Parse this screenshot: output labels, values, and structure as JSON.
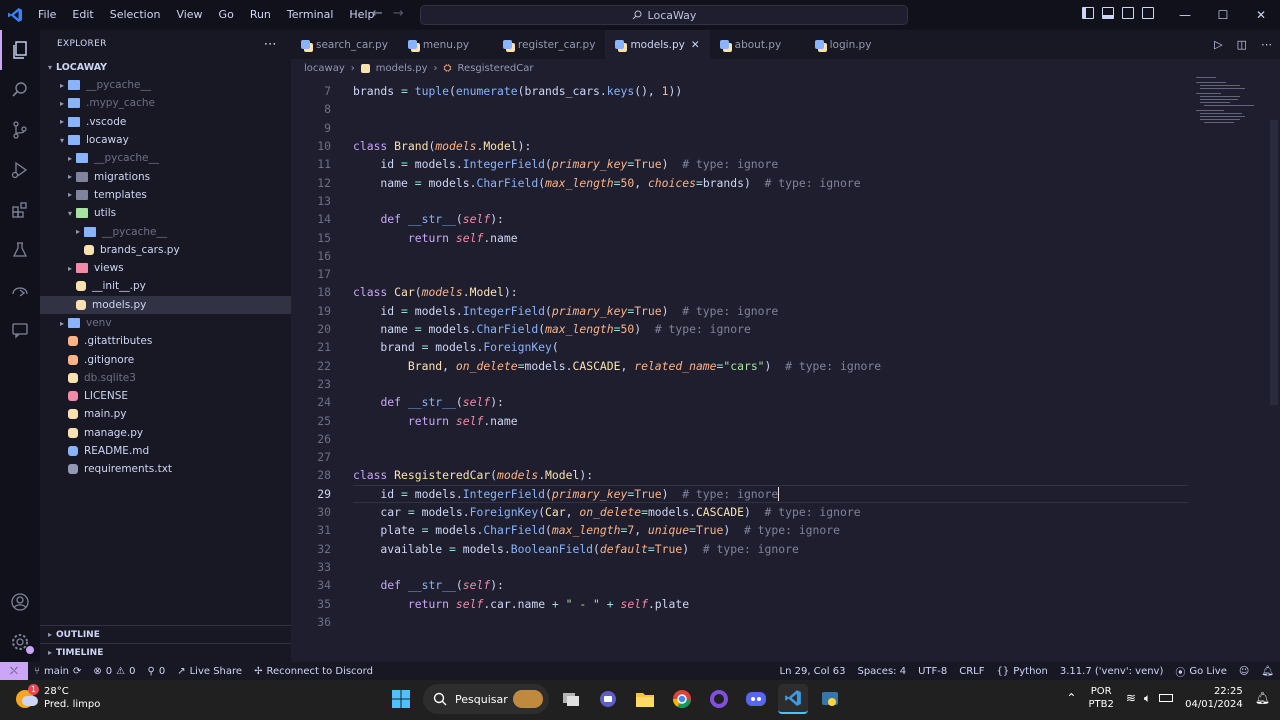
{
  "titlebar": {
    "menu": [
      "File",
      "Edit",
      "Selection",
      "View",
      "Go",
      "Run",
      "Terminal",
      "Help"
    ],
    "search_text": "LocaWay"
  },
  "explorer": {
    "title": "EXPLORER",
    "root": "LOCAWAY",
    "items": [
      {
        "label": "__pycache__",
        "depth": 1,
        "type": "folder",
        "color": "#89b4fa",
        "dim": true
      },
      {
        "label": ".mypy_cache",
        "depth": 1,
        "type": "folder",
        "color": "#89b4fa",
        "dim": true
      },
      {
        "label": ".vscode",
        "depth": 1,
        "type": "folder",
        "color": "#89b4fa",
        "dim": false
      },
      {
        "label": "locaway",
        "depth": 1,
        "type": "folder-open",
        "color": "#89b4fa",
        "dim": false
      },
      {
        "label": "__pycache__",
        "depth": 2,
        "type": "folder",
        "color": "#89b4fa",
        "dim": true
      },
      {
        "label": "migrations",
        "depth": 2,
        "type": "folder",
        "color": "#7f849c",
        "dim": false
      },
      {
        "label": "templates",
        "depth": 2,
        "type": "folder",
        "color": "#7f849c",
        "dim": false
      },
      {
        "label": "utils",
        "depth": 2,
        "type": "folder-open",
        "color": "#a6e3a1",
        "dim": false
      },
      {
        "label": "__pycache__",
        "depth": 3,
        "type": "folder",
        "color": "#89b4fa",
        "dim": true
      },
      {
        "label": "brands_cars.py",
        "depth": 3,
        "type": "py",
        "color": "#f9e2af",
        "dim": false
      },
      {
        "label": "views",
        "depth": 2,
        "type": "folder",
        "color": "#f38ba8",
        "dim": false
      },
      {
        "label": "__init__.py",
        "depth": 2,
        "type": "py",
        "color": "#f9e2af",
        "dim": false
      },
      {
        "label": "models.py",
        "depth": 2,
        "type": "py",
        "color": "#f9e2af",
        "dim": false,
        "selected": true
      },
      {
        "label": "venv",
        "depth": 1,
        "type": "folder",
        "color": "#89b4fa",
        "dim": true
      },
      {
        "label": ".gitattributes",
        "depth": 1,
        "type": "git",
        "color": "#fab387",
        "dim": false
      },
      {
        "label": ".gitignore",
        "depth": 1,
        "type": "git",
        "color": "#fab387",
        "dim": false
      },
      {
        "label": "db.sqlite3",
        "depth": 1,
        "type": "db",
        "color": "#f9e2af",
        "dim": true
      },
      {
        "label": "LICENSE",
        "depth": 1,
        "type": "license",
        "color": "#f38ba8",
        "dim": false
      },
      {
        "label": "main.py",
        "depth": 1,
        "type": "py",
        "color": "#f9e2af",
        "dim": false
      },
      {
        "label": "manage.py",
        "depth": 1,
        "type": "py",
        "color": "#f9e2af",
        "dim": false
      },
      {
        "label": "README.md",
        "depth": 1,
        "type": "md",
        "color": "#89b4fa",
        "dim": false
      },
      {
        "label": "requirements.txt",
        "depth": 1,
        "type": "txt",
        "color": "#9399b2",
        "dim": false
      }
    ],
    "outline": "OUTLINE",
    "timeline": "TIMELINE"
  },
  "tabs": [
    {
      "label": "search_car.py",
      "active": false
    },
    {
      "label": "menu.py",
      "active": false
    },
    {
      "label": "register_car.py",
      "active": false
    },
    {
      "label": "models.py",
      "active": true
    },
    {
      "label": "about.py",
      "active": false
    },
    {
      "label": "login.py",
      "active": false
    }
  ],
  "breadcrumb": [
    "locaway",
    "models.py",
    "ResgisteredCar"
  ],
  "code_lines": [
    {
      "n": "7",
      "html": "<span class='txt'>brands </span><span class='op'>=</span><span class='txt'> </span><span class='fn'>tuple</span><span class='txt'>(</span><span class='fn'>enumerate</span><span class='txt'>(brands_cars.</span><span class='fn'>keys</span><span class='txt'>(), </span><span class='num'>1</span><span class='txt'>))</span>"
    },
    {
      "n": "8",
      "html": ""
    },
    {
      "n": "9",
      "html": ""
    },
    {
      "n": "10",
      "html": "<span class='kw'>class</span><span class='txt'> </span><span class='cls'>Brand</span><span class='txt'>(</span><span class='param'>models</span><span class='txt'>.</span><span class='cls'>Model</span><span class='txt'>):</span>"
    },
    {
      "n": "11",
      "html": "<span class='txt'>    id </span><span class='op'>=</span><span class='txt'> models.</span><span class='fn'>IntegerField</span><span class='txt'>(</span><span class='param'>primary_key</span><span class='op'>=</span><span class='num'>True</span><span class='txt'>)  </span><span class='cmt'># type: ignore</span>"
    },
    {
      "n": "12",
      "html": "<span class='txt'>    name </span><span class='op'>=</span><span class='txt'> models.</span><span class='fn'>CharField</span><span class='txt'>(</span><span class='param'>max_length</span><span class='op'>=</span><span class='num'>50</span><span class='txt'>, </span><span class='param'>choices</span><span class='op'>=</span><span class='txt'>brands)  </span><span class='cmt'># type: ignore</span>"
    },
    {
      "n": "13",
      "html": ""
    },
    {
      "n": "14",
      "html": "<span class='txt'>    </span><span class='kw'>def</span><span class='txt'> </span><span class='fn'>__str__</span><span class='txt'>(</span><span class='self'>self</span><span class='txt'>):</span>"
    },
    {
      "n": "15",
      "html": "<span class='txt'>        </span><span class='kw'>return</span><span class='txt'> </span><span class='self'>self</span><span class='txt'>.name</span>"
    },
    {
      "n": "16",
      "html": ""
    },
    {
      "n": "17",
      "html": ""
    },
    {
      "n": "18",
      "html": "<span class='kw'>class</span><span class='txt'> </span><span class='cls'>Car</span><span class='txt'>(</span><span class='param'>models</span><span class='txt'>.</span><span class='cls'>Model</span><span class='txt'>):</span>"
    },
    {
      "n": "19",
      "html": "<span class='txt'>    id </span><span class='op'>=</span><span class='txt'> models.</span><span class='fn'>IntegerField</span><span class='txt'>(</span><span class='param'>primary_key</span><span class='op'>=</span><span class='num'>True</span><span class='txt'>)  </span><span class='cmt'># type: ignore</span>"
    },
    {
      "n": "20",
      "html": "<span class='txt'>    name </span><span class='op'>=</span><span class='txt'> models.</span><span class='fn'>CharField</span><span class='txt'>(</span><span class='param'>max_length</span><span class='op'>=</span><span class='num'>50</span><span class='txt'>)  </span><span class='cmt'># type: ignore</span>"
    },
    {
      "n": "21",
      "html": "<span class='txt'>    brand </span><span class='op'>=</span><span class='txt'> models.</span><span class='fn'>ForeignKey</span><span class='txt'>(</span>"
    },
    {
      "n": "22",
      "html": "<span class='txt'>        </span><span class='cls'>Brand</span><span class='txt'>, </span><span class='param'>on_delete</span><span class='op'>=</span><span class='txt'>models.</span><span class='cls'>CASCADE</span><span class='txt'>, </span><span class='param'>related_name</span><span class='op'>=</span><span class='str'>\"cars\"</span><span class='txt'>)  </span><span class='cmt'># type: ignore</span>"
    },
    {
      "n": "23",
      "html": ""
    },
    {
      "n": "24",
      "html": "<span class='txt'>    </span><span class='kw'>def</span><span class='txt'> </span><span class='fn'>__str__</span><span class='txt'>(</span><span class='self'>self</span><span class='txt'>):</span>"
    },
    {
      "n": "25",
      "html": "<span class='txt'>        </span><span class='kw'>return</span><span class='txt'> </span><span class='self'>self</span><span class='txt'>.name</span>"
    },
    {
      "n": "26",
      "html": ""
    },
    {
      "n": "27",
      "html": ""
    },
    {
      "n": "28",
      "html": "<span class='kw'>class</span><span class='txt'> </span><span class='cls'>ResgisteredCar</span><span class='txt'>(</span><span class='param'>models</span><span class='txt'>.</span><span class='cls'>Model</span><span class='txt'>):</span>"
    },
    {
      "n": "29",
      "html": "<span class='txt'>    id </span><span class='op'>=</span><span class='txt'> models.</span><span class='fn'>IntegerField</span><span class='txt'>(</span><span class='param'>primary_key</span><span class='op'>=</span><span class='num'>True</span><span class='txt'>)  </span><span class='cmt'># type: ignore</span><span style='border-left:1px solid #f5e0dc'></span>",
      "current": true
    },
    {
      "n": "30",
      "html": "<span class='txt'>    car </span><span class='op'>=</span><span class='txt'> models.</span><span class='fn'>ForeignKey</span><span class='txt'>(</span><span class='cls'>Car</span><span class='txt'>, </span><span class='param'>on_delete</span><span class='op'>=</span><span class='txt'>models.</span><span class='cls'>CASCADE</span><span class='txt'>)  </span><span class='cmt'># type: ignore</span>"
    },
    {
      "n": "31",
      "html": "<span class='txt'>    plate </span><span class='op'>=</span><span class='txt'> models.</span><span class='fn'>CharField</span><span class='txt'>(</span><span class='param'>max_length</span><span class='op'>=</span><span class='num'>7</span><span class='txt'>, </span><span class='param'>unique</span><span class='op'>=</span><span class='num'>True</span><span class='txt'>)  </span><span class='cmt'># type: ignore</span>"
    },
    {
      "n": "32",
      "html": "<span class='txt'>    available </span><span class='op'>=</span><span class='txt'> models.</span><span class='fn'>BooleanField</span><span class='txt'>(</span><span class='param'>default</span><span class='op'>=</span><span class='num'>True</span><span class='txt'>)  </span><span class='cmt'># type: ignore</span>"
    },
    {
      "n": "33",
      "html": ""
    },
    {
      "n": "34",
      "html": "<span class='txt'>    </span><span class='kw'>def</span><span class='txt'> </span><span class='fn'>__str__</span><span class='txt'>(</span><span class='self'>self</span><span class='txt'>):</span>"
    },
    {
      "n": "35",
      "html": "<span class='txt'>        </span><span class='kw'>return</span><span class='txt'> </span><span class='self'>self</span><span class='txt'>.car.name </span><span class='op'>+</span><span class='txt'> </span><span class='str'>\" - \"</span><span class='txt'> </span><span class='op'>+</span><span class='txt'> </span><span class='self'>self</span><span class='txt'>.plate</span>"
    },
    {
      "n": "36",
      "html": ""
    }
  ],
  "status": {
    "branch": "main",
    "errors": "0",
    "warnings": "0",
    "ports": "0",
    "live_share": "Live Share",
    "discord": "Reconnect to Discord",
    "position": "Ln 29, Col 63",
    "spaces": "Spaces: 4",
    "encoding": "UTF-8",
    "eol": "CRLF",
    "language": "Python",
    "interpreter": "3.11.7 ('venv': venv)",
    "go_live": "Go Live"
  },
  "taskbar": {
    "temp": "28°C",
    "weather": "Pred. limpo",
    "badge": "1",
    "search": "Pesquisar",
    "lang1": "POR",
    "lang2": "PTB2",
    "time": "22:25",
    "date": "04/01/2024"
  },
  "colors": {
    "accent": "#cba6f7",
    "bg": "#1e1e2e"
  }
}
